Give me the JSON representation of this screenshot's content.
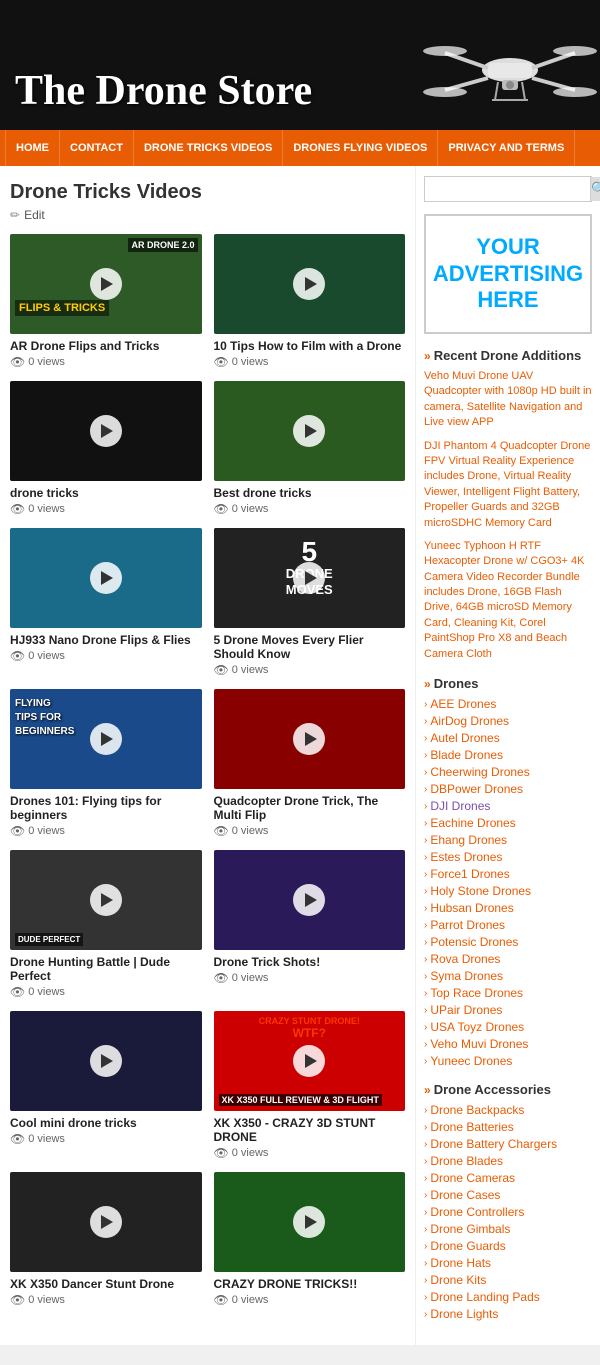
{
  "site": {
    "title": "The Drone Store"
  },
  "nav": {
    "items": [
      {
        "label": "HOME",
        "id": "home"
      },
      {
        "label": "CONTACT",
        "id": "contact"
      },
      {
        "label": "DRONE TRICKS VIDEOS",
        "id": "drone-tricks-videos"
      },
      {
        "label": "DRONES FLYING VIDEOS",
        "id": "drones-flying-videos"
      },
      {
        "label": "PRIVACY AND TERMS",
        "id": "privacy-terms"
      }
    ]
  },
  "content": {
    "page_title": "Drone Tricks Videos",
    "edit_label": "Edit",
    "videos": [
      {
        "id": "v1",
        "title": "AR Drone Flips and Tricks",
        "views": "0 views",
        "thumb_class": "vt-ar",
        "overlay_top": "AR DRONE 2.0",
        "overlay_bottom": "FLIPS & TRICKS"
      },
      {
        "id": "v2",
        "title": "10 Tips How to Film with a Drone",
        "views": "0 views",
        "thumb_class": "vt-film",
        "overlay_top": ""
      },
      {
        "id": "v3",
        "title": "drone tricks",
        "views": "0 views",
        "thumb_class": "vt-tricks",
        "overlay_top": ""
      },
      {
        "id": "v4",
        "title": "Best drone tricks",
        "views": "0 views",
        "thumb_class": "vt-best",
        "overlay_top": ""
      },
      {
        "id": "v5",
        "title": "HJ933 Nano Drone Flips & Flies",
        "views": "0 views",
        "thumb_class": "vt-hj933",
        "overlay_top": ""
      },
      {
        "id": "v6",
        "title": "5 Drone Moves Every Flier Should Know",
        "views": "0 views",
        "thumb_class": "vt-5moves",
        "overlay_big": "5",
        "overlay_sub": "DRONE\nMOVES"
      },
      {
        "id": "v7",
        "title": "Drones 101: Flying tips for beginners",
        "views": "0 views",
        "thumb_class": "vt-flying",
        "flying_text": "FLYING\nTIPS FOR\nBEGINNERS"
      },
      {
        "id": "v8",
        "title": "Quadcopter Drone Trick, The Multi Flip",
        "views": "0 views",
        "thumb_class": "vt-quad",
        "overlay_top": ""
      },
      {
        "id": "v9",
        "title": "Drone Hunting Battle | Dude Perfect",
        "views": "0 views",
        "thumb_class": "vt-hunt",
        "overlay_top": ""
      },
      {
        "id": "v10",
        "title": "Drone Trick Shots!",
        "views": "0 views",
        "thumb_class": "vt-trickshots",
        "overlay_top": ""
      },
      {
        "id": "v11",
        "title": "Cool mini drone tricks",
        "views": "0 views",
        "thumb_class": "vt-mini",
        "overlay_top": ""
      },
      {
        "id": "v12",
        "title": "XK X350 - CRAZY 3D STUNT DRONE",
        "views": "0 views",
        "thumb_class": "vt-xk350",
        "crazy_text": "CRAZY STUNT DRONE!\nWTF?",
        "xk_label": "XK X350 FULL REVIEW & 3D FLIGHT"
      },
      {
        "id": "v13",
        "title": "XK X350 Dancer Stunt Drone",
        "views": "0 views",
        "thumb_class": "vt-xk350dancer",
        "overlay_top": ""
      },
      {
        "id": "v14",
        "title": "CRAZY DRONE TRICKS!!",
        "views": "0 views",
        "thumb_class": "vt-crazy",
        "overlay_top": ""
      }
    ]
  },
  "sidebar": {
    "search_placeholder": "",
    "search_btn_icon": "🔍",
    "ad_text": "YOUR\nADVERTISING\nHERE",
    "recent_title": "Recent Drone Additions",
    "recent_items": [
      {
        "id": "r1",
        "text": "Veho Muvi Drone UAV Quadcopter with 1080p HD built in camera, Satellite Navigation and Live view APP"
      },
      {
        "id": "r2",
        "text": "DJI Phantom 4 Quadcopter Drone FPV Virtual Reality Experience includes Drone, Virtual Reality Viewer, Intelligent Flight Battery, Propeller Guards and 32GB microSDHC Memory Card"
      },
      {
        "id": "r3",
        "text": "Yuneec Typhoon H RTF Hexacopter Drone w/ CGO3+ 4K Camera Video Recorder Bundle includes Drone, 16GB Flash Drive, 64GB microSD Memory Card, Cleaning Kit, Corel PaintShop Pro X8 and Beach Camera Cloth"
      }
    ],
    "drones_title": "Drones",
    "drone_links": [
      {
        "id": "d1",
        "label": "AEE Drones"
      },
      {
        "id": "d2",
        "label": "AirDog Drones"
      },
      {
        "id": "d3",
        "label": "Autel Drones"
      },
      {
        "id": "d4",
        "label": "Blade Drones"
      },
      {
        "id": "d5",
        "label": "Cheerwing Drones"
      },
      {
        "id": "d6",
        "label": "DBPower Drones"
      },
      {
        "id": "d7",
        "label": "DJI Drones",
        "visited": true
      },
      {
        "id": "d8",
        "label": "Eachine Drones"
      },
      {
        "id": "d9",
        "label": "Ehang Drones"
      },
      {
        "id": "d10",
        "label": "Estes Drones"
      },
      {
        "id": "d11",
        "label": "Force1 Drones"
      },
      {
        "id": "d12",
        "label": "Holy Stone Drones"
      },
      {
        "id": "d13",
        "label": "Hubsan Drones"
      },
      {
        "id": "d14",
        "label": "Parrot Drones"
      },
      {
        "id": "d15",
        "label": "Potensic Drones"
      },
      {
        "id": "d16",
        "label": "Rova Drones"
      },
      {
        "id": "d17",
        "label": "Syma Drones"
      },
      {
        "id": "d18",
        "label": "Top Race Drones"
      },
      {
        "id": "d19",
        "label": "UPair Drones"
      },
      {
        "id": "d20",
        "label": "USA Toyz Drones"
      },
      {
        "id": "d21",
        "label": "Veho Muvi Drones"
      },
      {
        "id": "d22",
        "label": "Yuneec Drones"
      }
    ],
    "accessories_title": "Drone Accessories",
    "accessory_links": [
      {
        "id": "a1",
        "label": "Drone Backpacks"
      },
      {
        "id": "a2",
        "label": "Drone Batteries"
      },
      {
        "id": "a3",
        "label": "Drone Battery Chargers"
      },
      {
        "id": "a4",
        "label": "Drone Blades"
      },
      {
        "id": "a5",
        "label": "Drone Cameras"
      },
      {
        "id": "a6",
        "label": "Drone Cases"
      },
      {
        "id": "a7",
        "label": "Drone Controllers"
      },
      {
        "id": "a8",
        "label": "Drone Gimbals"
      },
      {
        "id": "a9",
        "label": "Drone Guards"
      },
      {
        "id": "a10",
        "label": "Drone Hats"
      },
      {
        "id": "a11",
        "label": "Drone Kits"
      },
      {
        "id": "a12",
        "label": "Drone Landing Pads"
      },
      {
        "id": "a13",
        "label": "Drone Lights"
      }
    ]
  }
}
